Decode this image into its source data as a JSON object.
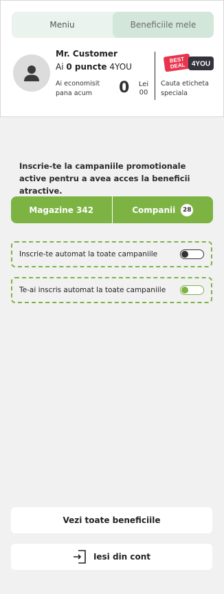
{
  "tabs": [
    {
      "label": "Meniu",
      "active": false
    },
    {
      "label": "Beneficiile mele",
      "active": true
    }
  ],
  "profile": {
    "name": "Mr. Customer",
    "points_prefix": "Ai",
    "points_value": "0 puncte",
    "points_suffix": "4YOU",
    "saved_label": "Ai economisit pana acum",
    "saved_amount": "0",
    "saved_currency_top": "Lei",
    "saved_currency_bottom": "00",
    "look_label": "Cauta eticheta speciala",
    "logo": {
      "line1": "BEST",
      "line2": "DEAL",
      "badge": "4YOU",
      "red": "#e8354e",
      "dark": "#34323d"
    }
  },
  "promo_text": "Inscrie-te la campaniile promotionale active pentru a avea acces la beneficii atractive.",
  "segments": [
    {
      "label": "Magazine 342",
      "badge": null
    },
    {
      "label": "Companii",
      "badge": "28"
    }
  ],
  "toggles": [
    {
      "label": "Inscrie-te automat la toate campaniile",
      "on": false
    },
    {
      "label": "Te-ai inscris automat la toate campaniile",
      "on": true
    }
  ],
  "buttons": {
    "all_benefits": "Vezi toate beneficiile",
    "logout": "Iesi din cont"
  },
  "colors": {
    "accent": "#7cb342",
    "tab_bg": "#eaf3ee",
    "tab_active": "#d3e6da",
    "page_bg": "#f1f1f1"
  }
}
